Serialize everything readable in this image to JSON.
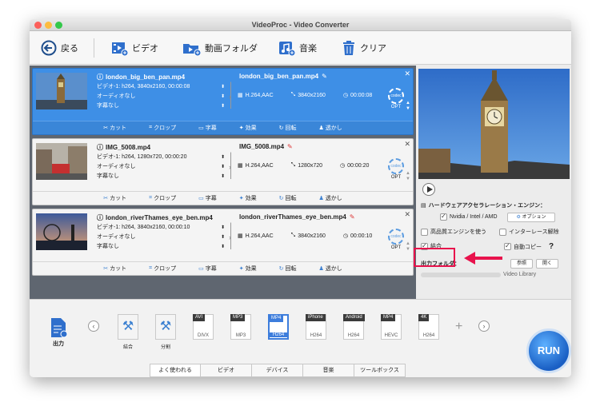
{
  "window": {
    "title": "VideoProc - Video Converter"
  },
  "colors": {
    "accent": "#3e8fe6",
    "highlight": "#e8124c",
    "traffic_close": "#fc605b",
    "traffic_min": "#fdbc40",
    "traffic_max": "#34c84a"
  },
  "toolbar": {
    "back_label": "戻る",
    "video_label": "ビデオ",
    "folder_label": "動画フォルダ",
    "music_label": "音楽",
    "clear_label": "クリア"
  },
  "files": [
    {
      "src_name": "london_big_ben_pan.mp4",
      "info": "ビデオ-1: h264, 3840x2160, 00:00:08",
      "audio": "オーディオなし",
      "subtitle": "字幕なし",
      "out_name": "london_big_ben_pan.mp4",
      "codec": "H.264,AAC",
      "resolution": "3840x2160",
      "duration": "00:00:08",
      "opt": "OPT"
    },
    {
      "src_name": "IMG_5008.mp4",
      "info": "ビデオ-1: h264, 1280x720, 00:00:20",
      "audio": "オーディオなし",
      "subtitle": "字幕なし",
      "out_name": "IMG_5008.mp4",
      "codec": "H.264,AAC",
      "resolution": "1280x720",
      "duration": "00:00:20",
      "opt": "OPT"
    },
    {
      "src_name": "london_riverThames_eye_ben.mp4",
      "info": "ビデオ-1: h264, 3840x2160, 00:00:10",
      "audio": "オーディオなし",
      "subtitle": "字幕なし",
      "out_name": "london_riverThames_eye_ben.mp4",
      "codec": "H.264,AAC",
      "resolution": "3840x2160",
      "duration": "00:00:10",
      "opt": "OPT"
    }
  ],
  "actions": {
    "cut": "カット",
    "crop": "クロップ",
    "subtitle": "字幕",
    "effect": "効果",
    "rotate": "回転",
    "watermark": "透かし"
  },
  "hw": {
    "title": "ハードウェアアクセラレーション・エンジン：",
    "nvidia": "Nvidia / Intel / AMD",
    "option": "オプション",
    "hq_engine": "高品質エンジンを使う",
    "deinterlace": "インターレース解除",
    "merge": "結合",
    "auto_copy": "自動コピー",
    "help": "?",
    "output_folder": "出力フォルダ：",
    "browse": "参照",
    "open": "開く",
    "path": "Video Library"
  },
  "bottom": {
    "output_label": "出力",
    "tools": [
      {
        "label": "結合"
      },
      {
        "label": "分割"
      }
    ],
    "formats": [
      {
        "tag": "AVI",
        "sub": "DIVX"
      },
      {
        "tag": "MP3",
        "sub": "MP3"
      },
      {
        "tag": "MP4",
        "sub": "H264"
      },
      {
        "tag": "iPhone",
        "sub": "H264"
      },
      {
        "tag": "Android",
        "sub": "H264"
      },
      {
        "tag": "MP4",
        "sub": "HEVC"
      },
      {
        "tag": "4K",
        "sub": "H264"
      }
    ],
    "tabs": [
      "よく使われる",
      "ビデオ",
      "デバイス",
      "音楽",
      "ツールボックス"
    ],
    "run_label": "RUN"
  }
}
